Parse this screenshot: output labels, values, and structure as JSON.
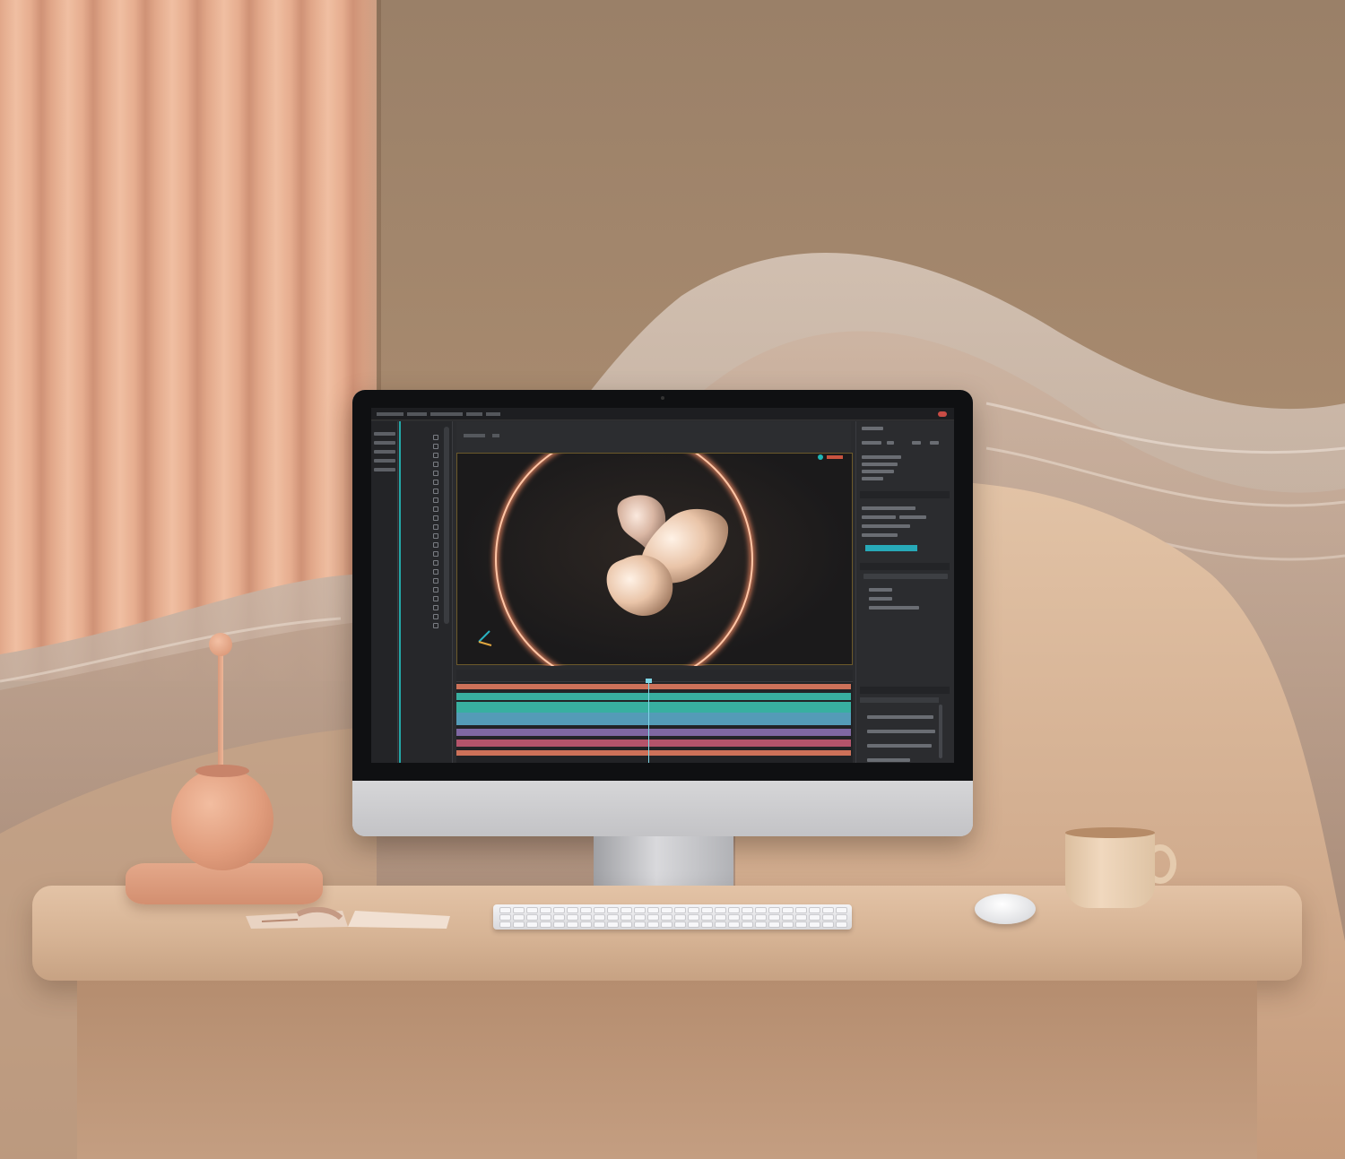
{
  "scene": {
    "palette": {
      "wall": "#a98b6f",
      "curtain": "#e2a88a",
      "desk": "#d6b394",
      "screen_bg": "#2a2b2e",
      "accent_teal": "#23a7a7",
      "accent_coral": "#e07a5f",
      "glow_ring": "#f0a07a"
    },
    "objects": [
      "curtain",
      "wave-wall",
      "desk",
      "monitor",
      "keyboard",
      "mouse",
      "mug",
      "vase",
      "open-book"
    ]
  },
  "screen_app": {
    "panels": [
      "left-nav",
      "tool-column",
      "viewport",
      "properties-panel",
      "timeline"
    ],
    "timeline_tracks": [
      {
        "color": "#e07a5f"
      },
      {
        "color": "#3bbfae"
      },
      {
        "color": "#3bbfae"
      },
      {
        "color": "#5aa8c8"
      },
      {
        "color": "#8a6fb0"
      },
      {
        "color": "#c45a73"
      },
      {
        "color": "#e07a5f"
      }
    ]
  }
}
